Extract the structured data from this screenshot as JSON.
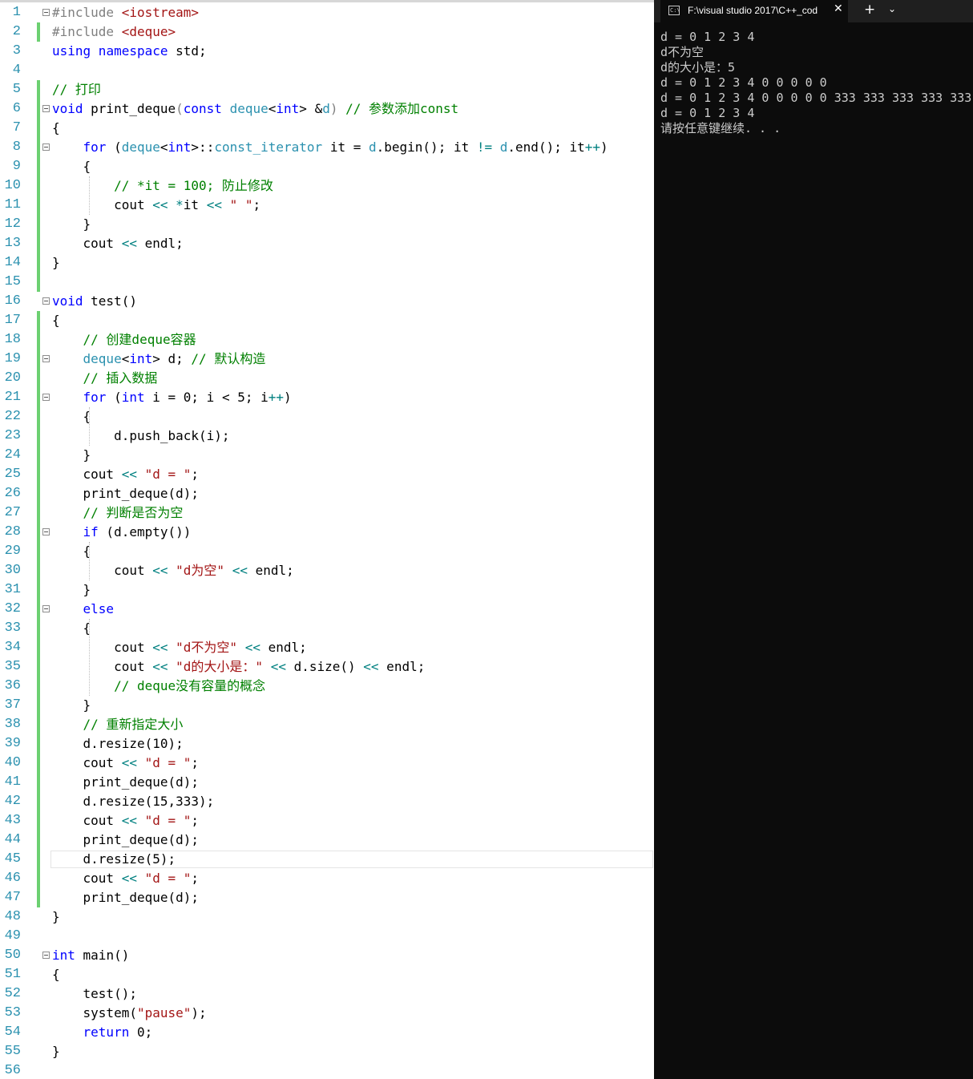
{
  "editor": {
    "lines": [
      {
        "n": "1",
        "fold": true,
        "tokens": [
          [
            "pre",
            "#include "
          ],
          [
            "str",
            "<iostream>"
          ]
        ]
      },
      {
        "n": "2",
        "change": true,
        "tokens": [
          [
            "pre",
            "#include "
          ],
          [
            "str",
            "<deque>"
          ]
        ]
      },
      {
        "n": "3",
        "tokens": [
          [
            "kw",
            "using"
          ],
          [
            "",
            ""
          ],
          [
            "",
            ""
          ],
          [
            "kw",
            " namespace"
          ],
          [
            "",
            " std;"
          ]
        ]
      },
      {
        "n": "4",
        "tokens": []
      },
      {
        "n": "5",
        "change": true,
        "tokens": [
          [
            "cmt",
            "// 打印"
          ]
        ]
      },
      {
        "n": "6",
        "fold": true,
        "change": true,
        "tokens": [
          [
            "kw",
            "void"
          ],
          [
            "",
            " print_deque"
          ],
          [
            "par",
            "("
          ],
          [
            "kw",
            "const"
          ],
          [
            "",
            " "
          ],
          [
            "typ",
            "deque"
          ],
          [
            "",
            "<"
          ],
          [
            "kw",
            "int"
          ],
          [
            "",
            "> &"
          ],
          [
            "typ",
            "d"
          ],
          [
            "par",
            ")"
          ],
          [
            "",
            " "
          ],
          [
            "cmt",
            "// 参数添加const"
          ]
        ]
      },
      {
        "n": "7",
        "change": true,
        "tokens": [
          [
            "",
            "{"
          ]
        ]
      },
      {
        "n": "8",
        "fold": true,
        "change": true,
        "tokens": [
          [
            "",
            "    "
          ],
          [
            "kw",
            "for"
          ],
          [
            "",
            " ("
          ],
          [
            "typ",
            "deque"
          ],
          [
            "",
            "<"
          ],
          [
            "kw",
            "int"
          ],
          [
            "",
            ">::"
          ],
          [
            "typ",
            "const_iterator"
          ],
          [
            "",
            " it = "
          ],
          [
            "typ",
            "d"
          ],
          [
            "",
            ".begin(); it "
          ],
          [
            "op",
            "!="
          ],
          [
            "",
            " "
          ],
          [
            "typ",
            "d"
          ],
          [
            "",
            ".end(); it"
          ],
          [
            "op",
            "++"
          ],
          [
            "",
            ")"
          ]
        ]
      },
      {
        "n": "9",
        "change": true,
        "tokens": [
          [
            "",
            "    {"
          ]
        ]
      },
      {
        "n": "10",
        "change": true,
        "tokens": [
          [
            "",
            "        "
          ],
          [
            "cmt",
            "// *it = 100; 防止修改"
          ]
        ]
      },
      {
        "n": "11",
        "change": true,
        "tokens": [
          [
            "",
            "        cout "
          ],
          [
            "op",
            "<<"
          ],
          [
            "",
            " "
          ],
          [
            "op",
            "*"
          ],
          [
            "",
            "it "
          ],
          [
            "op",
            "<<"
          ],
          [
            "",
            " "
          ],
          [
            "str",
            "\" \""
          ],
          [
            "",
            ";"
          ]
        ]
      },
      {
        "n": "12",
        "change": true,
        "tokens": [
          [
            "",
            "    }"
          ]
        ]
      },
      {
        "n": "13",
        "change": true,
        "tokens": [
          [
            "",
            "    cout "
          ],
          [
            "op",
            "<<"
          ],
          [
            "",
            " endl;"
          ]
        ]
      },
      {
        "n": "14",
        "change": true,
        "tokens": [
          [
            "",
            "}"
          ]
        ]
      },
      {
        "n": "15",
        "change": true,
        "tokens": []
      },
      {
        "n": "16",
        "fold": true,
        "tokens": [
          [
            "kw",
            "void"
          ],
          [
            "",
            " test()"
          ]
        ]
      },
      {
        "n": "17",
        "change": true,
        "tokens": [
          [
            "",
            "{"
          ]
        ]
      },
      {
        "n": "18",
        "change": true,
        "tokens": [
          [
            "",
            "    "
          ],
          [
            "cmt",
            "// 创建deque容器"
          ]
        ]
      },
      {
        "n": "19",
        "fold": true,
        "change": true,
        "tokens": [
          [
            "",
            "    "
          ],
          [
            "typ",
            "deque"
          ],
          [
            "",
            "<"
          ],
          [
            "kw",
            "int"
          ],
          [
            "",
            "> d; "
          ],
          [
            "cmt",
            "// 默认构造"
          ]
        ]
      },
      {
        "n": "20",
        "change": true,
        "tokens": [
          [
            "",
            "    "
          ],
          [
            "cmt",
            "// 插入数据"
          ]
        ]
      },
      {
        "n": "21",
        "fold": true,
        "change": true,
        "tokens": [
          [
            "",
            "    "
          ],
          [
            "kw",
            "for"
          ],
          [
            "",
            " ("
          ],
          [
            "kw",
            "int"
          ],
          [
            "",
            " i = 0; i < 5; i"
          ],
          [
            "op",
            "++"
          ],
          [
            "",
            ")"
          ]
        ]
      },
      {
        "n": "22",
        "change": true,
        "tokens": [
          [
            "",
            "    {"
          ]
        ]
      },
      {
        "n": "23",
        "change": true,
        "tokens": [
          [
            "",
            "        d.push_back(i);"
          ]
        ]
      },
      {
        "n": "24",
        "change": true,
        "tokens": [
          [
            "",
            "    }"
          ]
        ]
      },
      {
        "n": "25",
        "change": true,
        "tokens": [
          [
            "",
            "    cout "
          ],
          [
            "op",
            "<<"
          ],
          [
            "",
            " "
          ],
          [
            "str",
            "\"d = \""
          ],
          [
            "",
            ";"
          ]
        ]
      },
      {
        "n": "26",
        "change": true,
        "tokens": [
          [
            "",
            "    print_deque(d);"
          ]
        ]
      },
      {
        "n": "27",
        "change": true,
        "tokens": [
          [
            "",
            "    "
          ],
          [
            "cmt",
            "// 判断是否为空"
          ]
        ]
      },
      {
        "n": "28",
        "fold": true,
        "change": true,
        "tokens": [
          [
            "",
            "    "
          ],
          [
            "kw",
            "if"
          ],
          [
            "",
            " (d.empty())"
          ]
        ]
      },
      {
        "n": "29",
        "change": true,
        "tokens": [
          [
            "",
            "    {"
          ]
        ]
      },
      {
        "n": "30",
        "change": true,
        "tokens": [
          [
            "",
            "        cout "
          ],
          [
            "op",
            "<<"
          ],
          [
            "",
            " "
          ],
          [
            "str",
            "\"d为空\""
          ],
          [
            "",
            " "
          ],
          [
            "op",
            "<<"
          ],
          [
            "",
            " endl;"
          ]
        ]
      },
      {
        "n": "31",
        "change": true,
        "tokens": [
          [
            "",
            "    }"
          ]
        ]
      },
      {
        "n": "32",
        "fold": true,
        "change": true,
        "tokens": [
          [
            "",
            "    "
          ],
          [
            "kw",
            "else"
          ]
        ]
      },
      {
        "n": "33",
        "change": true,
        "tokens": [
          [
            "",
            "    {"
          ]
        ]
      },
      {
        "n": "34",
        "change": true,
        "tokens": [
          [
            "",
            "        cout "
          ],
          [
            "op",
            "<<"
          ],
          [
            "",
            " "
          ],
          [
            "str",
            "\"d不为空\""
          ],
          [
            "",
            " "
          ],
          [
            "op",
            "<<"
          ],
          [
            "",
            " endl;"
          ]
        ]
      },
      {
        "n": "35",
        "change": true,
        "tokens": [
          [
            "",
            "        cout "
          ],
          [
            "op",
            "<<"
          ],
          [
            "",
            " "
          ],
          [
            "str",
            "\"d的大小是：\""
          ],
          [
            "",
            " "
          ],
          [
            "op",
            "<<"
          ],
          [
            "",
            " d.size() "
          ],
          [
            "op",
            "<<"
          ],
          [
            "",
            " endl;"
          ]
        ]
      },
      {
        "n": "36",
        "change": true,
        "tokens": [
          [
            "",
            "        "
          ],
          [
            "cmt",
            "// deque没有容量的概念"
          ]
        ]
      },
      {
        "n": "37",
        "change": true,
        "tokens": [
          [
            "",
            "    }"
          ]
        ]
      },
      {
        "n": "38",
        "change": true,
        "tokens": [
          [
            "",
            "    "
          ],
          [
            "cmt",
            "// 重新指定大小"
          ]
        ]
      },
      {
        "n": "39",
        "change": true,
        "tokens": [
          [
            "",
            "    d.resize(10);"
          ]
        ]
      },
      {
        "n": "40",
        "change": true,
        "tokens": [
          [
            "",
            "    cout "
          ],
          [
            "op",
            "<<"
          ],
          [
            "",
            " "
          ],
          [
            "str",
            "\"d = \""
          ],
          [
            "",
            ";"
          ]
        ]
      },
      {
        "n": "41",
        "change": true,
        "tokens": [
          [
            "",
            "    print_deque(d);"
          ]
        ]
      },
      {
        "n": "42",
        "change": true,
        "tokens": [
          [
            "",
            "    d.resize(15,333);"
          ]
        ]
      },
      {
        "n": "43",
        "change": true,
        "tokens": [
          [
            "",
            "    cout "
          ],
          [
            "op",
            "<<"
          ],
          [
            "",
            " "
          ],
          [
            "str",
            "\"d = \""
          ],
          [
            "",
            ";"
          ]
        ]
      },
      {
        "n": "44",
        "change": true,
        "tokens": [
          [
            "",
            "    print_deque(d);"
          ]
        ]
      },
      {
        "n": "45",
        "change": true,
        "current": true,
        "tokens": [
          [
            "",
            "    d.resize(5);"
          ]
        ]
      },
      {
        "n": "46",
        "change": true,
        "tokens": [
          [
            "",
            "    cout "
          ],
          [
            "op",
            "<<"
          ],
          [
            "",
            " "
          ],
          [
            "str",
            "\"d = \""
          ],
          [
            "",
            ";"
          ]
        ]
      },
      {
        "n": "47",
        "change": true,
        "tokens": [
          [
            "",
            "    print_deque(d);"
          ]
        ]
      },
      {
        "n": "48",
        "tokens": [
          [
            "",
            "}"
          ]
        ]
      },
      {
        "n": "49",
        "tokens": []
      },
      {
        "n": "50",
        "fold": true,
        "tokens": [
          [
            "kw",
            "int"
          ],
          [
            "",
            " main()"
          ]
        ]
      },
      {
        "n": "51",
        "tokens": [
          [
            "",
            "{"
          ]
        ]
      },
      {
        "n": "52",
        "tokens": [
          [
            "",
            "    test();"
          ]
        ]
      },
      {
        "n": "53",
        "tokens": [
          [
            "",
            "    system("
          ],
          [
            "str",
            "\"pause\""
          ],
          [
            "",
            ");"
          ]
        ]
      },
      {
        "n": "54",
        "tokens": [
          [
            "",
            "    "
          ],
          [
            "kw",
            "return"
          ],
          [
            "",
            " 0;"
          ]
        ]
      },
      {
        "n": "55",
        "tokens": [
          [
            "",
            "}"
          ]
        ]
      },
      {
        "n": "56",
        "tokens": []
      }
    ]
  },
  "terminal": {
    "tab_icon": "console-icon",
    "tab_icon_text": "C:\\",
    "tab_title": "F:\\visual studio 2017\\C++_cod",
    "close_glyph": "✕",
    "new_tab_glyph": "+",
    "dropdown_glyph": "⌄",
    "output": [
      "d = 0 1 2 3 4",
      "d不为空",
      "d的大小是：5",
      "d = 0 1 2 3 4 0 0 0 0 0",
      "d = 0 1 2 3 4 0 0 0 0 0 333 333 333 333 333",
      "d = 0 1 2 3 4",
      "请按任意键继续. . ."
    ]
  },
  "colors": {
    "editor_bg": "#ffffff",
    "line_number": "#2b91af",
    "keyword": "#0000ff",
    "string": "#a31515",
    "comment": "#008000",
    "type": "#2b91af",
    "change_bar": "#6cd071",
    "terminal_bg": "#0c0c0c",
    "terminal_text": "#cccccc"
  }
}
